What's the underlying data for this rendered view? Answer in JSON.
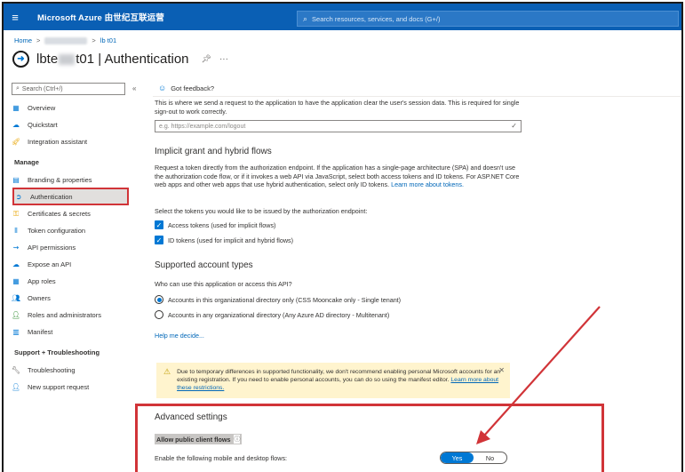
{
  "topbar": {
    "menu_icon": "hamburger-icon",
    "brand": "Microsoft Azure 由世纪互联运营",
    "search_placeholder": "Search resources, services, and docs (G+/)"
  },
  "breadcrumb": {
    "home": "Home",
    "sep": ">",
    "crumb_suffix": "lb     t01"
  },
  "page": {
    "title_prefix": "lbte",
    "title_suffix": "t01 | Authentication",
    "pin_icon": "pin-icon",
    "more_icon": "ellipsis-icon"
  },
  "sidebar": {
    "search_placeholder": "Search (Ctrl+/)",
    "collapse": "«",
    "items_top": [
      {
        "label": "Overview",
        "icon": "overview-icon"
      },
      {
        "label": "Quickstart",
        "icon": "quickstart-icon"
      },
      {
        "label": "Integration assistant",
        "icon": "rocket-icon"
      }
    ],
    "manage_heading": "Manage",
    "manage_items": [
      {
        "label": "Branding & properties",
        "icon": "branding-icon"
      },
      {
        "label": "Authentication",
        "icon": "authentication-icon",
        "active": true
      },
      {
        "label": "Certificates & secrets",
        "icon": "key-icon"
      },
      {
        "label": "Token configuration",
        "icon": "token-icon"
      },
      {
        "label": "API permissions",
        "icon": "api-permissions-icon"
      },
      {
        "label": "Expose an API",
        "icon": "cloud-icon"
      },
      {
        "label": "App roles",
        "icon": "app-roles-icon"
      },
      {
        "label": "Owners",
        "icon": "owners-icon"
      },
      {
        "label": "Roles and administrators",
        "icon": "roles-icon"
      },
      {
        "label": "Manifest",
        "icon": "manifest-icon"
      }
    ],
    "support_heading": "Support + Troubleshooting",
    "support_items": [
      {
        "label": "Troubleshooting",
        "icon": "wrench-icon"
      },
      {
        "label": "New support request",
        "icon": "support-icon"
      }
    ]
  },
  "main": {
    "feedback": "Got feedback?",
    "logout_desc": "This is where we send a request to the application to have the application clear the user's session data. This is required for single sign-out to work correctly.",
    "logout_placeholder": "e.g. https://example.com/logout",
    "implicit_heading": "Implicit grant and hybrid flows",
    "implicit_desc": "Request a token directly from the authorization endpoint. If the application has a single-page architecture (SPA) and doesn't use the authorization code flow, or if it invokes a web API via JavaScript, select both access tokens and ID tokens. For ASP.NET Core web apps and other web apps that use hybrid authentication, select only ID tokens.",
    "implicit_link": "Learn more about tokens.",
    "tokens_prompt": "Select the tokens you would like to be issued by the authorization endpoint:",
    "access_tokens": "Access tokens (used for implicit flows)",
    "id_tokens": "ID tokens (used for implicit and hybrid flows)",
    "account_heading": "Supported account types",
    "account_prompt": "Who can use this application or access this API?",
    "account_single": "Accounts in this organizational directory only (CSS Mooncake only - Single tenant)",
    "account_multi": "Accounts in any organizational directory (Any Azure AD directory - Multitenant)",
    "help_link": "Help me decide...",
    "warning_text": "Due to temporary differences in supported functionality, we don't recommend enabling personal Microsoft accounts for an existing registration. If you need to enable personal accounts, you can do so using the manifest editor.",
    "warning_link": "Learn more about these restrictions.",
    "advanced_heading": "Advanced settings",
    "allow_public": "Allow public client flows",
    "enable_flows": "Enable the following mobile and desktop flows:",
    "toggle_yes": "Yes",
    "toggle_no": "No"
  },
  "colors": {
    "topbar": "#0a5fb4",
    "accent": "#0078d4",
    "highlight": "#d13438",
    "warning_bg": "#fff4ce"
  }
}
